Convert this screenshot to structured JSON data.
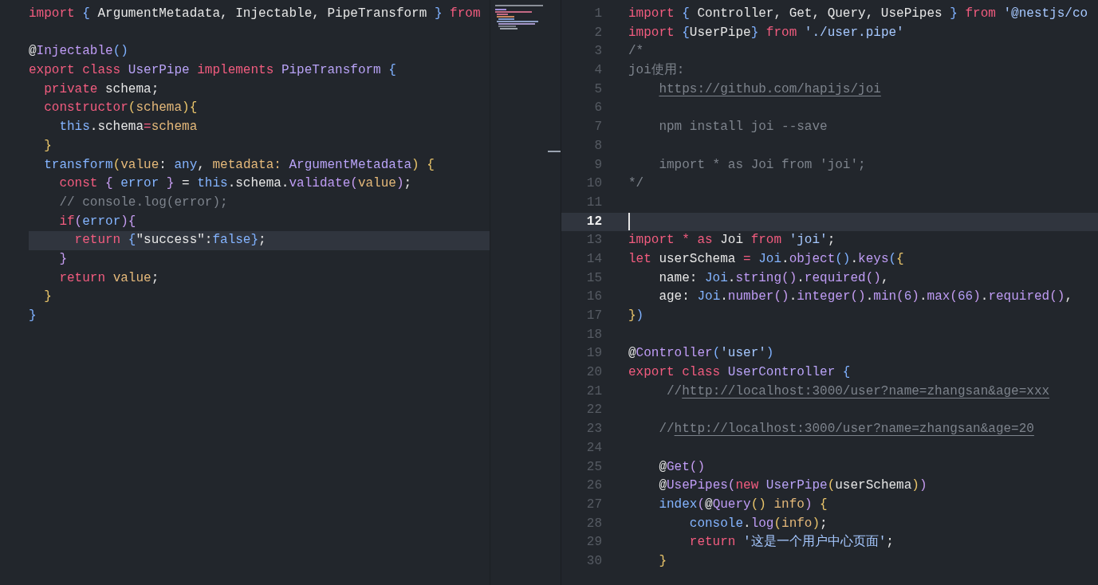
{
  "left_editor": {
    "lines": [
      {
        "current": false,
        "tokens": [
          {
            "kind": "kw",
            "text": "import "
          },
          {
            "kind": "p3",
            "text": "{"
          },
          {
            "kind": "plain",
            "text": " ArgumentMetadata, Injectable, PipeTransform "
          },
          {
            "kind": "p3",
            "text": "}"
          },
          {
            "kind": "kw",
            "text": " from"
          }
        ]
      },
      {
        "current": false
      },
      {
        "current": false,
        "tokens": [
          {
            "kind": "plain",
            "text": "@"
          },
          {
            "kind": "fn",
            "text": "Injectable"
          },
          {
            "kind": "p3",
            "text": "()"
          }
        ]
      },
      {
        "current": false,
        "tokens": [
          {
            "kind": "kw",
            "text": "export class "
          },
          {
            "kind": "type",
            "text": "UserPipe "
          },
          {
            "kind": "kw",
            "text": "implements "
          },
          {
            "kind": "type",
            "text": "PipeTransform "
          },
          {
            "kind": "p3",
            "text": "{"
          }
        ]
      },
      {
        "current": false,
        "tokens": [
          {
            "kind": "kw",
            "text": "  private "
          },
          {
            "kind": "plain",
            "text": "schema;"
          }
        ]
      },
      {
        "current": false,
        "tokens": [
          {
            "kind": "kw",
            "text": "  constructor"
          },
          {
            "kind": "p1",
            "text": "("
          },
          {
            "kind": "param",
            "text": "schema"
          },
          {
            "kind": "p1",
            "text": "){"
          }
        ]
      },
      {
        "current": false,
        "tokens": [
          {
            "kind": "var",
            "text": "    this"
          },
          {
            "kind": "plain",
            "text": ".schema"
          },
          {
            "kind": "kw",
            "text": "="
          },
          {
            "kind": "param",
            "text": "schema"
          }
        ]
      },
      {
        "current": false,
        "tokens": [
          {
            "kind": "p1",
            "text": "  }"
          }
        ]
      },
      {
        "current": false,
        "tokens": [
          {
            "kind": "var",
            "text": "  transform"
          },
          {
            "kind": "p1",
            "text": "("
          },
          {
            "kind": "param",
            "text": "value"
          },
          {
            "kind": "plain",
            "text": ": "
          },
          {
            "kind": "var",
            "text": "any"
          },
          {
            "kind": "plain",
            "text": ", "
          },
          {
            "kind": "param",
            "text": "metadata: "
          },
          {
            "kind": "type",
            "text": "ArgumentMetadata"
          },
          {
            "kind": "p1",
            "text": ") {"
          }
        ]
      },
      {
        "current": false,
        "tokens": [
          {
            "kind": "kw",
            "text": "    const "
          },
          {
            "kind": "p2",
            "text": "{ "
          },
          {
            "kind": "var",
            "text": "error "
          },
          {
            "kind": "p2",
            "text": "}"
          },
          {
            "kind": "plain",
            "text": " = "
          },
          {
            "kind": "var",
            "text": "this"
          },
          {
            "kind": "plain",
            "text": ".schema."
          },
          {
            "kind": "fn",
            "text": "validate"
          },
          {
            "kind": "p2",
            "text": "("
          },
          {
            "kind": "param",
            "text": "value"
          },
          {
            "kind": "p2",
            "text": ")"
          },
          {
            "kind": "plain",
            "text": ";"
          }
        ]
      },
      {
        "current": false,
        "tokens": [
          {
            "kind": "comment",
            "text": "    // console.log(error);"
          }
        ]
      },
      {
        "current": false,
        "tokens": [
          {
            "kind": "kw",
            "text": "    if"
          },
          {
            "kind": "p2",
            "text": "("
          },
          {
            "kind": "var",
            "text": "error"
          },
          {
            "kind": "p2",
            "text": "){"
          }
        ]
      },
      {
        "current": true,
        "tokens": [
          {
            "kind": "kw",
            "text": "      return "
          },
          {
            "kind": "p3",
            "text": "{"
          },
          {
            "kind": "plain",
            "text": "\"success\":"
          },
          {
            "kind": "var",
            "text": "false"
          },
          {
            "kind": "p3",
            "text": "}"
          },
          {
            "kind": "plain",
            "text": ";"
          }
        ]
      },
      {
        "current": false,
        "tokens": [
          {
            "kind": "p2",
            "text": "    }"
          }
        ]
      },
      {
        "current": false,
        "tokens": [
          {
            "kind": "kw",
            "text": "    return "
          },
          {
            "kind": "param",
            "text": "value"
          },
          {
            "kind": "plain",
            "text": ";"
          }
        ]
      },
      {
        "current": false,
        "tokens": [
          {
            "kind": "p1",
            "text": "  }"
          }
        ]
      },
      {
        "current": false,
        "tokens": [
          {
            "kind": "p3",
            "text": "}"
          }
        ]
      }
    ]
  },
  "right_editor": {
    "lines": [
      {
        "number": "1",
        "current": false,
        "tokens": [
          {
            "kind": "kw",
            "text": "import "
          },
          {
            "kind": "p3",
            "text": "{ "
          },
          {
            "kind": "plain",
            "text": "Controller, Get, Query, UsePipes "
          },
          {
            "kind": "p3",
            "text": "} "
          },
          {
            "kind": "kw",
            "text": "from "
          },
          {
            "kind": "str",
            "text": "'@nestjs/co"
          }
        ]
      },
      {
        "number": "2",
        "current": false,
        "tokens": [
          {
            "kind": "kw",
            "text": "import "
          },
          {
            "kind": "p3",
            "text": "{"
          },
          {
            "kind": "plain",
            "text": "UserPipe"
          },
          {
            "kind": "p3",
            "text": "} "
          },
          {
            "kind": "kw",
            "text": "from "
          },
          {
            "kind": "str",
            "text": "'./user.pipe'"
          }
        ]
      },
      {
        "number": "3",
        "current": false,
        "tokens": [
          {
            "kind": "comment",
            "text": "/*"
          }
        ]
      },
      {
        "number": "4",
        "current": false,
        "tokens": [
          {
            "kind": "comment",
            "text": "joi使用:"
          }
        ]
      },
      {
        "number": "5",
        "current": false,
        "tokens": [
          {
            "kind": "link",
            "text": "    https://github.com/hapijs/joi"
          }
        ]
      },
      {
        "number": "6",
        "current": false
      },
      {
        "number": "7",
        "current": false,
        "tokens": [
          {
            "kind": "comment",
            "text": "    npm install joi --save"
          }
        ]
      },
      {
        "number": "8",
        "current": false
      },
      {
        "number": "9",
        "current": false,
        "tokens": [
          {
            "kind": "comment",
            "text": "    import * as Joi from 'joi';"
          }
        ]
      },
      {
        "number": "10",
        "current": false,
        "tokens": [
          {
            "kind": "comment",
            "text": "*/"
          }
        ]
      },
      {
        "number": "11",
        "current": false
      },
      {
        "number": "12",
        "current": true
      },
      {
        "number": "13",
        "current": false,
        "tokens": [
          {
            "kind": "kw",
            "text": "import * as "
          },
          {
            "kind": "plain",
            "text": "Joi "
          },
          {
            "kind": "kw",
            "text": "from "
          },
          {
            "kind": "str",
            "text": "'joi'"
          },
          {
            "kind": "plain",
            "text": ";"
          }
        ]
      },
      {
        "number": "14",
        "current": false,
        "tokens": [
          {
            "kind": "kw",
            "text": "let "
          },
          {
            "kind": "plain",
            "text": "userSchema "
          },
          {
            "kind": "kw",
            "text": "= "
          },
          {
            "kind": "var",
            "text": "Joi"
          },
          {
            "kind": "plain",
            "text": "."
          },
          {
            "kind": "fn",
            "text": "object"
          },
          {
            "kind": "p3",
            "text": "()"
          },
          {
            "kind": "plain",
            "text": "."
          },
          {
            "kind": "fn",
            "text": "keys"
          },
          {
            "kind": "p3",
            "text": "("
          },
          {
            "kind": "p1",
            "text": "{"
          }
        ]
      },
      {
        "number": "15",
        "current": false,
        "tokens": [
          {
            "kind": "plain",
            "text": "    name: "
          },
          {
            "kind": "var",
            "text": "Joi"
          },
          {
            "kind": "plain",
            "text": "."
          },
          {
            "kind": "fn",
            "text": "string"
          },
          {
            "kind": "p2",
            "text": "()"
          },
          {
            "kind": "plain",
            "text": "."
          },
          {
            "kind": "fn",
            "text": "required"
          },
          {
            "kind": "p2",
            "text": "()"
          },
          {
            "kind": "plain",
            "text": ","
          }
        ]
      },
      {
        "number": "16",
        "current": false,
        "tokens": [
          {
            "kind": "plain",
            "text": "    age: "
          },
          {
            "kind": "var",
            "text": "Joi"
          },
          {
            "kind": "plain",
            "text": "."
          },
          {
            "kind": "fn",
            "text": "number"
          },
          {
            "kind": "p2",
            "text": "()"
          },
          {
            "kind": "plain",
            "text": "."
          },
          {
            "kind": "fn",
            "text": "integer"
          },
          {
            "kind": "p2",
            "text": "()"
          },
          {
            "kind": "plain",
            "text": "."
          },
          {
            "kind": "fn",
            "text": "min"
          },
          {
            "kind": "p2",
            "text": "("
          },
          {
            "kind": "num",
            "text": "6"
          },
          {
            "kind": "p2",
            "text": ")"
          },
          {
            "kind": "plain",
            "text": "."
          },
          {
            "kind": "fn",
            "text": "max"
          },
          {
            "kind": "p2",
            "text": "("
          },
          {
            "kind": "num",
            "text": "66"
          },
          {
            "kind": "p2",
            "text": ")"
          },
          {
            "kind": "plain",
            "text": "."
          },
          {
            "kind": "fn",
            "text": "required"
          },
          {
            "kind": "p2",
            "text": "()"
          },
          {
            "kind": "plain",
            "text": ","
          }
        ]
      },
      {
        "number": "17",
        "current": false,
        "tokens": [
          {
            "kind": "p1",
            "text": "}"
          },
          {
            "kind": "p3",
            "text": ")"
          }
        ]
      },
      {
        "number": "18",
        "current": false
      },
      {
        "number": "19",
        "current": false,
        "tokens": [
          {
            "kind": "plain",
            "text": "@"
          },
          {
            "kind": "fn",
            "text": "Controller"
          },
          {
            "kind": "p3",
            "text": "("
          },
          {
            "kind": "str",
            "text": "'user'"
          },
          {
            "kind": "p3",
            "text": ")"
          }
        ]
      },
      {
        "number": "20",
        "current": false,
        "tokens": [
          {
            "kind": "kw",
            "text": "export class "
          },
          {
            "kind": "type",
            "text": "UserController "
          },
          {
            "kind": "p3",
            "text": "{"
          }
        ]
      },
      {
        "number": "21",
        "current": false,
        "tokens": [
          {
            "kind": "comment",
            "text": "     //"
          },
          {
            "kind": "link",
            "text": "http://localhost:3000/user?name=zhangsan&age=xxx"
          }
        ]
      },
      {
        "number": "22",
        "current": false
      },
      {
        "number": "23",
        "current": false,
        "tokens": [
          {
            "kind": "comment",
            "text": "    //"
          },
          {
            "kind": "link",
            "text": "http://localhost:3000/user?name=zhangsan&age=20"
          }
        ]
      },
      {
        "number": "24",
        "current": false
      },
      {
        "number": "25",
        "current": false,
        "tokens": [
          {
            "kind": "plain",
            "text": "    @"
          },
          {
            "kind": "fn",
            "text": "Get"
          },
          {
            "kind": "p2",
            "text": "()"
          }
        ]
      },
      {
        "number": "26",
        "current": false,
        "tokens": [
          {
            "kind": "plain",
            "text": "    @"
          },
          {
            "kind": "fn",
            "text": "UsePipes"
          },
          {
            "kind": "p2",
            "text": "("
          },
          {
            "kind": "kw",
            "text": "new "
          },
          {
            "kind": "type",
            "text": "UserPipe"
          },
          {
            "kind": "p1",
            "text": "("
          },
          {
            "kind": "plain",
            "text": "userSchema"
          },
          {
            "kind": "p1",
            "text": ")"
          },
          {
            "kind": "p2",
            "text": ")"
          }
        ]
      },
      {
        "number": "27",
        "current": false,
        "tokens": [
          {
            "kind": "var",
            "text": "    index"
          },
          {
            "kind": "p2",
            "text": "("
          },
          {
            "kind": "plain",
            "text": "@"
          },
          {
            "kind": "fn",
            "text": "Query"
          },
          {
            "kind": "p1",
            "text": "()"
          },
          {
            "kind": "param",
            "text": " info"
          },
          {
            "kind": "p2",
            "text": ")"
          },
          {
            "kind": "p1",
            "text": " {"
          }
        ]
      },
      {
        "number": "28",
        "current": false,
        "tokens": [
          {
            "kind": "var",
            "text": "        console"
          },
          {
            "kind": "plain",
            "text": "."
          },
          {
            "kind": "fn",
            "text": "log"
          },
          {
            "kind": "p1",
            "text": "("
          },
          {
            "kind": "param",
            "text": "info"
          },
          {
            "kind": "p1",
            "text": ")"
          },
          {
            "kind": "plain",
            "text": ";"
          }
        ]
      },
      {
        "number": "29",
        "current": false,
        "tokens": [
          {
            "kind": "kw",
            "text": "        return "
          },
          {
            "kind": "str",
            "text": "'这是一个用户中心页面'"
          },
          {
            "kind": "plain",
            "text": ";"
          }
        ]
      },
      {
        "number": "30",
        "current": false,
        "tokens": [
          {
            "kind": "p1",
            "text": "    }"
          }
        ]
      }
    ]
  }
}
